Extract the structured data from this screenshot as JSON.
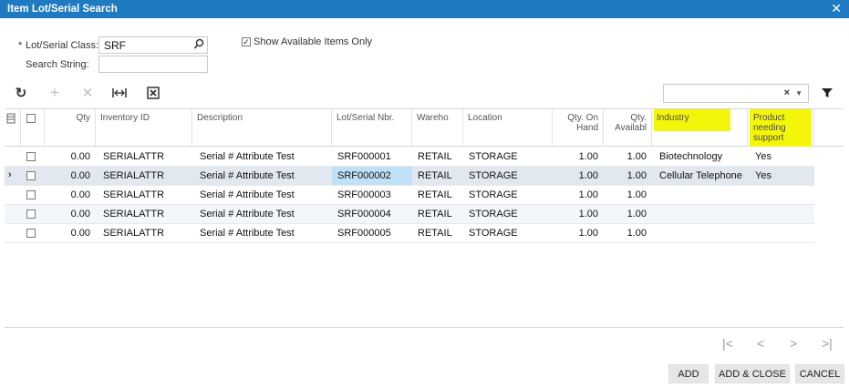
{
  "window": {
    "title": "Item Lot/Serial Search",
    "close_icon": "close-icon"
  },
  "form": {
    "required_mark": "*",
    "lot_class_label": "Lot/Serial Class:",
    "lot_class_value": "SRF",
    "search_label": "Search String:",
    "search_value": "",
    "show_available_label": "Show Available Items Only",
    "show_available_checked": true
  },
  "toolbar": {
    "refresh_icon": "refresh-icon",
    "add_icon": "plus-icon",
    "delete_icon": "delete-icon",
    "fit_icon": "fit-columns-icon",
    "export_icon": "export-excel-icon",
    "filter_value": "",
    "clear_icon": "clear-icon",
    "dropdown_icon": "chevron-down-icon",
    "funnel_icon": "filter-icon"
  },
  "grid": {
    "columns": {
      "qty": "Qty",
      "inventory_id": "Inventory ID",
      "description": "Description",
      "lot_serial": "Lot/Serial Nbr.",
      "warehouse": "Wareho",
      "location": "Location",
      "qty_on_hand": "Qty. On Hand",
      "qty_available": "Qty. Availabl",
      "industry": "Industry",
      "product_support": "Product needing support"
    },
    "rows": [
      {
        "qty": "0.00",
        "inventory_id": "SERIALATTR",
        "description": "Serial # Attribute Test",
        "lot_serial": "SRF000001",
        "warehouse": "RETAIL",
        "location": "STORAGE",
        "qty_on_hand": "1.00",
        "qty_available": "1.00",
        "industry": "Biotechnology",
        "product_support": "Yes"
      },
      {
        "qty": "0.00",
        "inventory_id": "SERIALATTR",
        "description": "Serial # Attribute Test",
        "lot_serial": "SRF000002",
        "warehouse": "RETAIL",
        "location": "STORAGE",
        "qty_on_hand": "1.00",
        "qty_available": "1.00",
        "industry": "Cellular Telephone",
        "product_support": "Yes"
      },
      {
        "qty": "0.00",
        "inventory_id": "SERIALATTR",
        "description": "Serial # Attribute Test",
        "lot_serial": "SRF000003",
        "warehouse": "RETAIL",
        "location": "STORAGE",
        "qty_on_hand": "1.00",
        "qty_available": "1.00",
        "industry": "",
        "product_support": ""
      },
      {
        "qty": "0.00",
        "inventory_id": "SERIALATTR",
        "description": "Serial # Attribute Test",
        "lot_serial": "SRF000004",
        "warehouse": "RETAIL",
        "location": "STORAGE",
        "qty_on_hand": "1.00",
        "qty_available": "1.00",
        "industry": "",
        "product_support": ""
      },
      {
        "qty": "0.00",
        "inventory_id": "SERIALATTR",
        "description": "Serial # Attribute Test",
        "lot_serial": "SRF000005",
        "warehouse": "RETAIL",
        "location": "STORAGE",
        "qty_on_hand": "1.00",
        "qty_available": "1.00",
        "industry": "",
        "product_support": ""
      }
    ],
    "selected_row_marker": "›"
  },
  "pager": {
    "first": "|<",
    "prev": "<",
    "next": ">",
    "last": ">|"
  },
  "buttons": {
    "add": "ADD",
    "add_close": "ADD & CLOSE",
    "cancel": "CANCEL"
  },
  "colors": {
    "titlebar": "#1f7bc1",
    "highlight": "#f4f60a",
    "active_cell": "#bfe0f6"
  }
}
